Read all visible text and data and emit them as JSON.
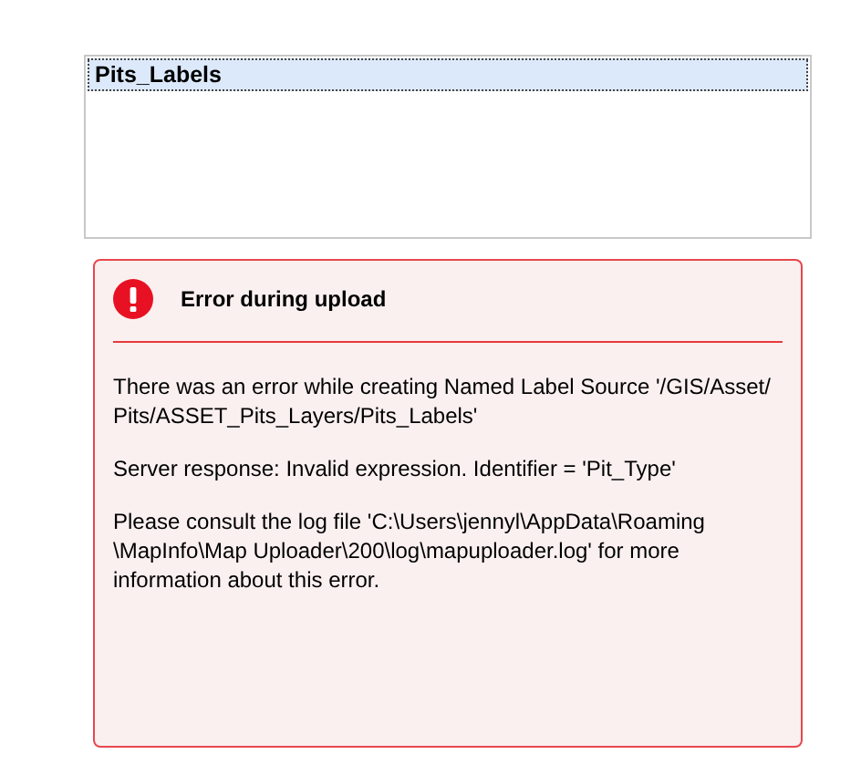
{
  "list": {
    "items": [
      {
        "label": "Pits_Labels",
        "selected": true
      }
    ]
  },
  "error": {
    "title": "Error during upload",
    "paragraphs": [
      [
        "There was an error while creating Named Label Source '/GIS/Asset/",
        "Pits/ASSET_Pits_Layers/Pits_Labels'"
      ],
      [
        "Server response: Invalid expression. Identifier = 'Pit_Type'"
      ],
      [
        "Please consult the log file 'C:\\Users\\jennyl\\AppData\\Roaming",
        "\\MapInfo\\Map Uploader\\200\\log\\mapuploader.log' for more",
        "information about this error."
      ]
    ]
  }
}
